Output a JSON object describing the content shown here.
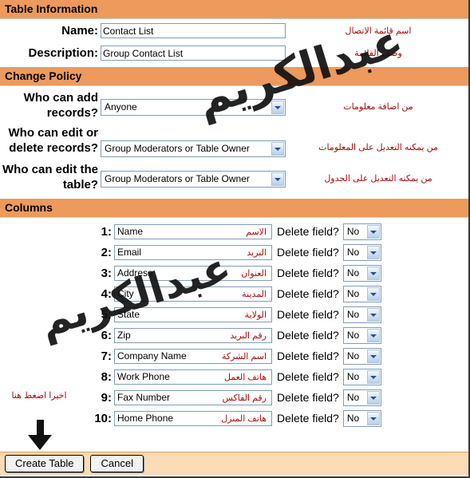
{
  "sections": {
    "table_information": "Table Information",
    "change_policy": "Change Policy",
    "columns": "Columns"
  },
  "table_information": {
    "name_label": "Name:",
    "name_value": "Contact List",
    "name_note": "اسم قائمة الاتصال",
    "description_label": "Description:",
    "description_value": "Group Contact List",
    "description_note": "وصف القائمة"
  },
  "change_policy": {
    "add_label": "Who can add records?",
    "add_value": "Anyone",
    "add_note": "من اضافة معلومات",
    "edit_delete_label": "Who can edit or delete records?",
    "edit_delete_value": "Group Moderators or Table Owner",
    "edit_delete_note": "من يمكنه التعديل على المعلومات",
    "edit_table_label": "Who can edit the table?",
    "edit_table_value": "Group Moderators or Table Owner",
    "edit_table_note": "من يمكنه التعديل على الجدول"
  },
  "columns": {
    "delete_label": "Delete field?",
    "delete_value": "No",
    "rows": [
      {
        "num": "1:",
        "value": "Name",
        "note": "الاسم",
        "delete": "No"
      },
      {
        "num": "2:",
        "value": "Email",
        "note": "البريد",
        "delete": "No"
      },
      {
        "num": "3:",
        "value": "Address",
        "note": "العنوان",
        "delete": "No"
      },
      {
        "num": "4:",
        "value": "City",
        "note": "المدينة",
        "delete": "No"
      },
      {
        "num": "5:",
        "value": "State",
        "note": "الولاية",
        "delete": "No"
      },
      {
        "num": "6:",
        "value": "Zip",
        "note": "رقم البريد",
        "delete": "No"
      },
      {
        "num": "7:",
        "value": "Company Name",
        "note": "اسم الشركة",
        "delete": "No"
      },
      {
        "num": "8:",
        "value": "Work Phone",
        "note": "هاتف العمل",
        "delete": "No"
      },
      {
        "num": "9:",
        "value": "Fax Number",
        "note": "رقم الفاكس",
        "delete": "No"
      },
      {
        "num": "10:",
        "value": "Home Phone",
        "note": "هاتف المنزل",
        "delete": "No"
      }
    ]
  },
  "footer": {
    "create_label": "Create Table",
    "cancel_label": "Cancel"
  },
  "annotations": {
    "click_here": "اخيرا اضغط هنا",
    "watermark": "عبدالكريم"
  },
  "colors": {
    "section_bar": "#ed9a5c",
    "footer_bg": "#fbdcb4",
    "annotation_red": "#b00d0d",
    "input_border": "#7f9db9"
  }
}
